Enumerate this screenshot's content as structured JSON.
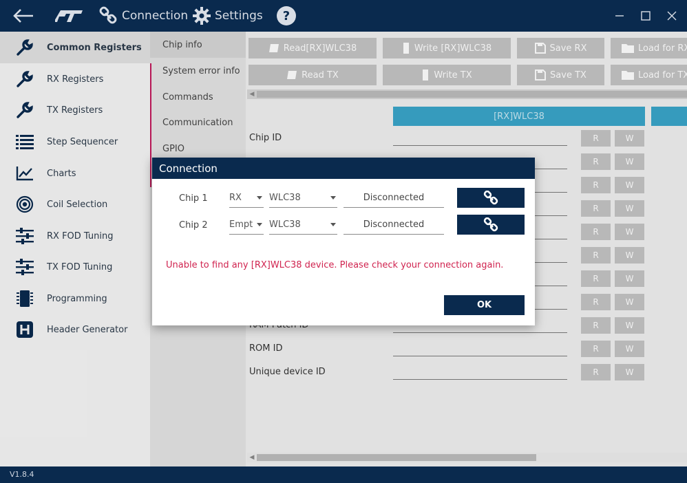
{
  "topbar": {
    "connection_label": "Connection",
    "settings_label": "Settings"
  },
  "sidebar": {
    "items": [
      {
        "label": "Common Registers",
        "icon": "wrench-icon"
      },
      {
        "label": "RX Registers",
        "icon": "wrench-icon"
      },
      {
        "label": "TX Registers",
        "icon": "wrench-icon"
      },
      {
        "label": "Step Sequencer",
        "icon": "list-icon"
      },
      {
        "label": "Charts",
        "icon": "chart-icon"
      },
      {
        "label": "Coil Selection",
        "icon": "coil-icon"
      },
      {
        "label": "RX FOD Tuning",
        "icon": "sliders-icon"
      },
      {
        "label": "TX FOD Tuning",
        "icon": "sliders-icon"
      },
      {
        "label": "Programming",
        "icon": "chip-icon"
      },
      {
        "label": "Header Generator",
        "icon": "header-icon"
      }
    ]
  },
  "subnav": {
    "items": [
      "Chip info",
      "System error info",
      "Commands",
      "Communication",
      "GPIO"
    ]
  },
  "toolbar": {
    "read_rx": "Read[RX]WLC38",
    "write_rx": "Write [RX]WLC38",
    "save_rx": "Save RX",
    "load_rx": "Load for RX",
    "read_tx": "Read TX",
    "write_tx": "Write TX",
    "save_tx": "Save TX",
    "load_tx": "Load for TX"
  },
  "table": {
    "column_header": "[RX]WLC38",
    "read_label": "R",
    "write_label": "W",
    "rows": [
      "Chip ID",
      "",
      "",
      "",
      "",
      "",
      "",
      "",
      "RAM Patch ID",
      "ROM ID",
      "Unique device ID"
    ]
  },
  "dialog": {
    "title": "Connection",
    "chip1": {
      "label": "Chip 1",
      "role": "RX",
      "device": "WLC38",
      "status": "Disconnected"
    },
    "chip2": {
      "label": "Chip 2",
      "role": "Empt",
      "device": "WLC38",
      "status": "Disconnected"
    },
    "error": "Unable to find any [RX]WLC38 device. Please check your connection again.",
    "ok_label": "OK"
  },
  "footer": {
    "version": "V1.8.4"
  },
  "colors": {
    "navy": "#0a2a4e",
    "accent": "#3aa5c9",
    "error": "#d0234f"
  }
}
